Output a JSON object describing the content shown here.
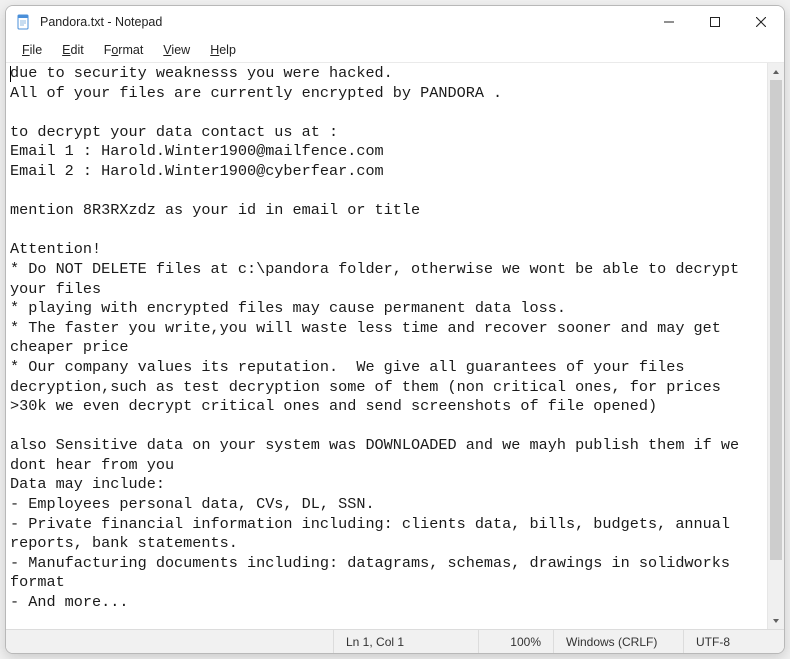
{
  "titlebar": {
    "title": "Pandora.txt - Notepad"
  },
  "menubar": {
    "items": [
      {
        "label": "File",
        "ukey": "F"
      },
      {
        "label": "Edit",
        "ukey": "E"
      },
      {
        "label": "Format",
        "ukey": "o"
      },
      {
        "label": "View",
        "ukey": "V"
      },
      {
        "label": "Help",
        "ukey": "H"
      }
    ]
  },
  "editor": {
    "text": "due to security weaknesss you were hacked.\nAll of your files are currently encrypted by PANDORA .\n\nto decrypt your data contact us at :\nEmail 1 : Harold.Winter1900@mailfence.com\nEmail 2 : Harold.Winter1900@cyberfear.com\n\nmention 8R3RXzdz as your id in email or title\n\nAttention!\n* Do NOT DELETE files at c:\\pandora folder, otherwise we wont be able to decrypt your files\n* playing with encrypted files may cause permanent data loss.\n* The faster you write,you will waste less time and recover sooner and may get cheaper price\n* Our company values its reputation.  We give all guarantees of your files decryption,such as test decryption some of them (non critical ones, for prices >30k we even decrypt critical ones and send screenshots of file opened)\n\nalso Sensitive data on your system was DOWNLOADED and we mayh publish them if we dont hear from you\nData may include:\n- Employees personal data, CVs, DL, SSN.\n- Private financial information including: clients data, bills, budgets, annual reports, bank statements.\n- Manufacturing documents including: datagrams, schemas, drawings in solidworks format\n- And more..."
  },
  "statusbar": {
    "lncol": "Ln 1, Col 1",
    "zoom": "100%",
    "eol": "Windows (CRLF)",
    "encoding": "UTF-8"
  }
}
